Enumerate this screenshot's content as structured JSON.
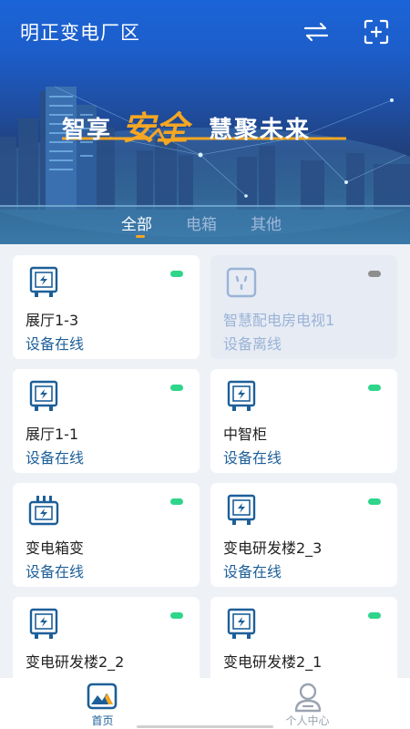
{
  "header": {
    "title": "明正变电厂区",
    "swap_icon": "swap-arrows-icon",
    "scan_icon": "scan-add-icon"
  },
  "banner": {
    "slogan_part1": "智享",
    "slogan_part2": "安全",
    "slogan_part3": "慧聚未来"
  },
  "tabs": [
    {
      "label": "全部",
      "active": true
    },
    {
      "label": "电箱",
      "active": false
    },
    {
      "label": "其他",
      "active": false
    }
  ],
  "devices": [
    {
      "name": "展厅1-3",
      "status": "设备在线",
      "online": true,
      "icon": "electric-box-icon"
    },
    {
      "name": "智慧配电房电视1",
      "status": "设备离线",
      "online": false,
      "icon": "power-socket-icon"
    },
    {
      "name": "展厅1-1",
      "status": "设备在线",
      "online": true,
      "icon": "electric-box-icon"
    },
    {
      "name": "中智柜",
      "status": "设备在线",
      "online": true,
      "icon": "electric-box-icon"
    },
    {
      "name": "变电箱变",
      "status": "设备在线",
      "online": true,
      "icon": "transformer-icon"
    },
    {
      "name": "变电研发楼2_3",
      "status": "设备在线",
      "online": true,
      "icon": "electric-box-icon"
    },
    {
      "name": "变电研发楼2_2",
      "status": "",
      "online": true,
      "icon": "electric-box-icon"
    },
    {
      "name": "变电研发楼2_1",
      "status": "",
      "online": true,
      "icon": "electric-box-icon"
    }
  ],
  "bottom_nav": {
    "home": "首页",
    "profile": "个人中心"
  },
  "colors": {
    "accent": "#1d5f99",
    "online_dot": "#2ed58a",
    "offline_dot": "#8e8e8e",
    "slogan_orange": "#f5a623"
  }
}
